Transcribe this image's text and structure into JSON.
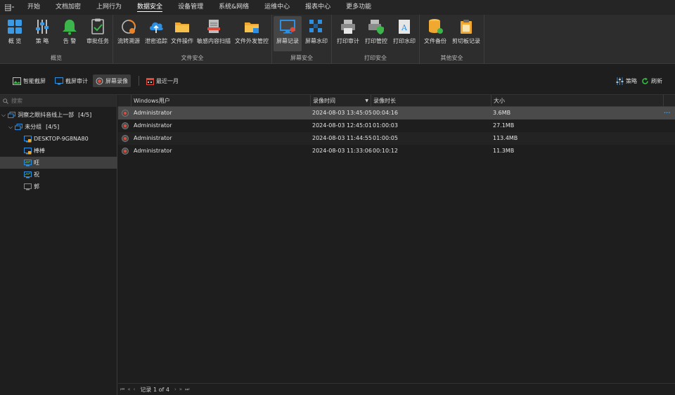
{
  "menubar": {
    "tabs": [
      "开始",
      "文档加密",
      "上网行为",
      "数据安全",
      "设备管理",
      "系统&网络",
      "运维中心",
      "报表中心",
      "更多功能"
    ],
    "active_tab": "数据安全"
  },
  "ribbon": {
    "groups": [
      {
        "label": "概览",
        "buttons": [
          "概 览",
          "策 略",
          "告 警",
          "审批任务"
        ]
      },
      {
        "label": "文件安全",
        "buttons": [
          "流转溯源",
          "泄密追踪",
          "文件操作",
          "敏感内容扫描",
          "文件外发管控"
        ]
      },
      {
        "label": "屏幕安全",
        "buttons": [
          "屏幕记录",
          "屏幕水印"
        ]
      },
      {
        "label": "打印安全",
        "buttons": [
          "打印审计",
          "打印管控",
          "打印水印"
        ]
      },
      {
        "label": "其他安全",
        "buttons": [
          "文件备份",
          "剪切板记录"
        ]
      }
    ],
    "active_button": "屏幕记录"
  },
  "toolbar": {
    "smart_capture": "智能截屏",
    "capture_audit": "截屏审计",
    "screen_video": "屏幕录像",
    "date_range": "最近一月",
    "policy": "策略",
    "refresh": "刷新"
  },
  "tree": {
    "search_placeholder": "搜索",
    "root": {
      "label": "洞察之眼抖音线上一部",
      "count": "[4/5]"
    },
    "group": {
      "label": "未分组",
      "count": "[4/5]"
    },
    "computers": [
      "DESKTOP-9G8NA80",
      "棒棒",
      "旺",
      "祝",
      "郭"
    ],
    "selected": "旺"
  },
  "grid": {
    "columns": [
      "Windows用户",
      "录像时间",
      "录像时长",
      "大小"
    ],
    "rows": [
      {
        "user": "Administrator",
        "time": "2024-08-03 13:45:05",
        "duration": "00:04:16",
        "size": "3.6MB"
      },
      {
        "user": "Administrator",
        "time": "2024-08-03 12:45:01",
        "duration": "01:00:03",
        "size": "27.1MB"
      },
      {
        "user": "Administrator",
        "time": "2024-08-03 11:44:55",
        "duration": "01:00:05",
        "size": "113.4MB"
      },
      {
        "user": "Administrator",
        "time": "2024-08-03 11:33:06",
        "duration": "00:10:12",
        "size": "11.3MB"
      }
    ],
    "row_more": "···"
  },
  "pager": {
    "text": "记录 1 of 4",
    "first": "⏮",
    "prev_page": "«",
    "prev": "‹",
    "next": "›",
    "next_page": "»",
    "last": "⏭"
  },
  "colors": {
    "background": "#1e1e1e",
    "ribbon": "#2d2d2d",
    "selected_row": "#4a4a4a",
    "accent_blue": "#1e90e8",
    "record_red": "#e04a3a"
  }
}
